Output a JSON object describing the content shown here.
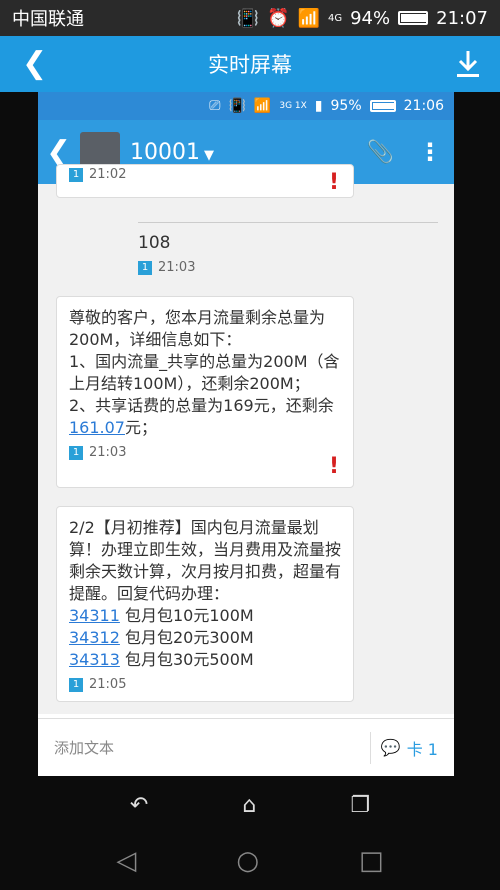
{
  "outer_status": {
    "carrier": "中国联通",
    "network": "4G",
    "battery": "94%",
    "time": "21:07",
    "battery_level": 0.94
  },
  "outer_bar": {
    "title": "实时屏幕"
  },
  "inner_status": {
    "signal_label": "3G 1X",
    "battery": "95%",
    "time": "21:06",
    "battery_level": 0.95
  },
  "chat": {
    "contact": "10001"
  },
  "messages": {
    "prev_time": "21:02",
    "sent_text": "108",
    "sent_time": "21:03",
    "msg1": {
      "line1": "尊敬的客户，您本月流量剩余总量为200M，详细信息如下：",
      "line2": "1、国内流量_共享的总量为200M（含上月结转100M），还剩余200M；",
      "line3_pre": "2、共享话费的总量为169元，还剩余",
      "amount": "161.07",
      "line3_post": "元；",
      "time": "21:03"
    },
    "msg2": {
      "intro": "2/2【月初推荐】国内包月流量最划算！办理立即生效，当月费用及流量按剩余天数计算，次月按月扣费，超量有提醒。回复代码办理：",
      "codes": [
        {
          "code": "34311",
          "desc": " 包月包10元100M"
        },
        {
          "code": "34312",
          "desc": " 包月包20元300M"
        },
        {
          "code": "34313",
          "desc": " 包月包30元500M"
        }
      ],
      "time": "21:05"
    }
  },
  "compose": {
    "placeholder": "添加文本",
    "send_label": "卡 1"
  },
  "sim_label": "1"
}
